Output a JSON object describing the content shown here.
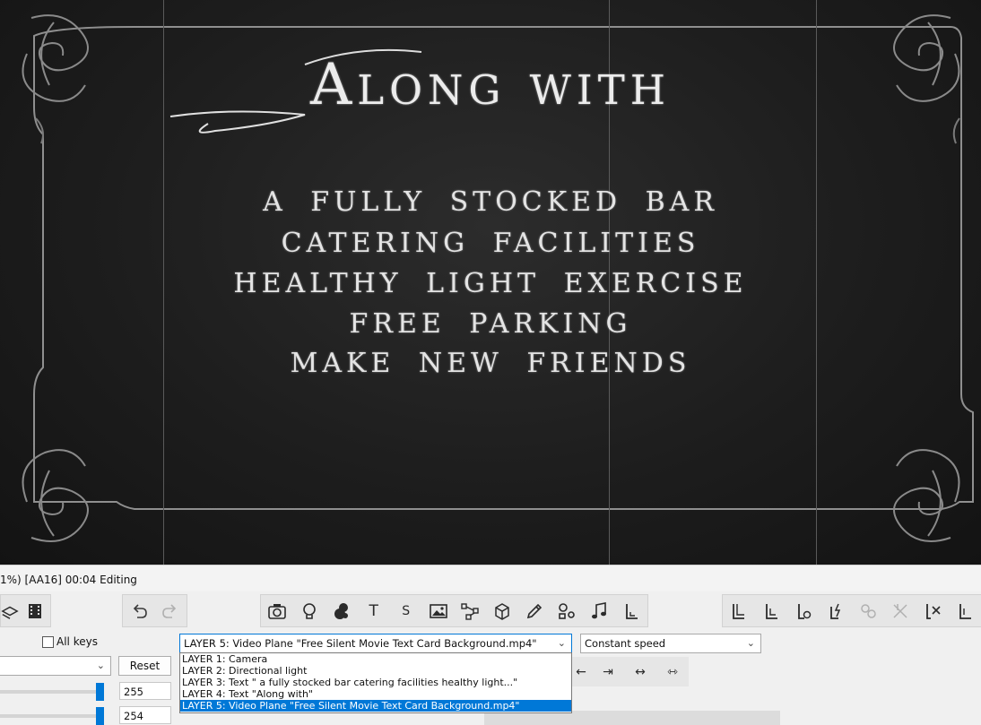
{
  "preview": {
    "title": "Along with",
    "lines": [
      "a fully stocked bar",
      "catering facilities",
      "healthy light exercise",
      "free parking",
      "make new friends"
    ]
  },
  "status": {
    "text": "1%) [AA16] 00:04 Editing"
  },
  "toolbar": {
    "left_icons": [
      "layers-icon",
      "film-icon"
    ],
    "history_icons": [
      "undo-icon",
      "redo-icon"
    ],
    "insert_icons": [
      "camera-icon",
      "light-bulb-icon",
      "particles-icon",
      "text-icon",
      "subtitle-icon",
      "image-icon",
      "path-icon",
      "cube-icon",
      "pen-icon",
      "shapes-icon",
      "music-note-icon",
      "layer-icon"
    ],
    "text_glyph": "T",
    "subtitle_glyph": "S",
    "right_icons": [
      "layer-link-icon",
      "layer-unlink-icon",
      "layer-parent-icon",
      "layer-child-icon",
      "layer-group-icon",
      "layer-ungroup-icon",
      "layer-remove-icon",
      "layer-collapse-icon"
    ]
  },
  "controls": {
    "all_keys_label": "All keys",
    "reset_label": "Reset",
    "value_1": "255",
    "value_2": "254",
    "layer_select_value": "LAYER 5: Video Plane \"Free Silent Movie Text Card Background.mp4\"",
    "speed_select_value": "Constant speed"
  },
  "layer_options": [
    "LAYER 1: Camera",
    "LAYER 2: Directional light",
    "LAYER 3: Text \" a fully stocked bar catering facilities healthy light...\"",
    "LAYER 4: Text \"Along with\"",
    "LAYER 5: Video Plane \"Free Silent Movie Text Card Background.mp4\""
  ],
  "selected_layer_index": 4,
  "colors": {
    "accent": "#0078d7",
    "card_background": "#1f1f1f",
    "card_text": "#e8e8e8"
  }
}
